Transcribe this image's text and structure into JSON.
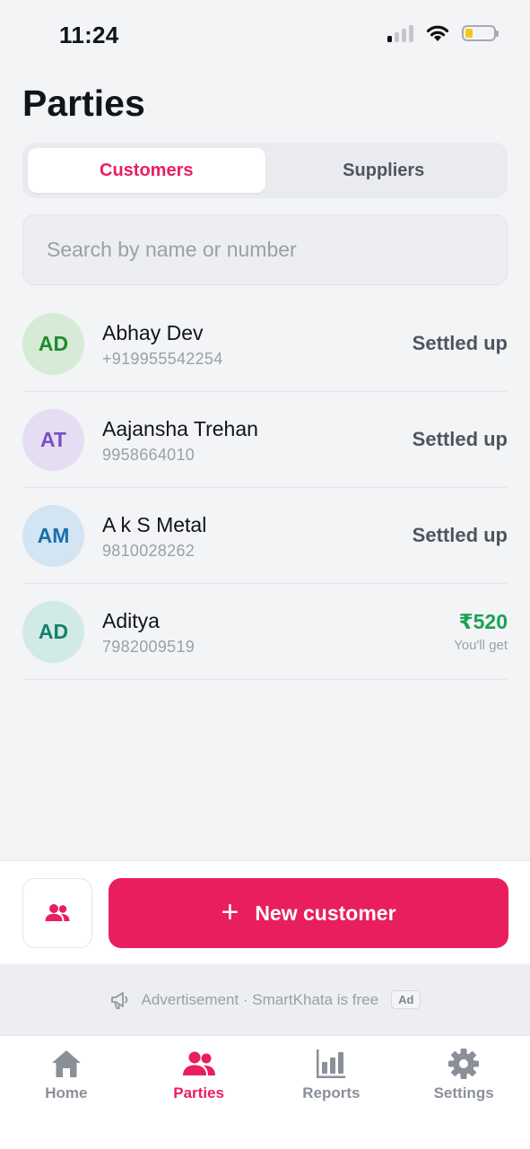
{
  "status_bar": {
    "time": "11:24"
  },
  "page": {
    "title": "Parties"
  },
  "segments": [
    {
      "label": "Customers",
      "active": true
    },
    {
      "label": "Suppliers",
      "active": false
    }
  ],
  "search": {
    "placeholder": "Search by name or number",
    "value": ""
  },
  "parties": [
    {
      "initials": "AD",
      "name": "Abhay Dev",
      "phone": "+919955542254",
      "status": "Settled up",
      "avatar_bg": "#d5ebd6",
      "avatar_fg": "#218a2d"
    },
    {
      "initials": "AT",
      "name": "Aajansha Trehan",
      "phone": "9958664010",
      "status": "Settled up",
      "avatar_bg": "#e5def3",
      "avatar_fg": "#7a4fc0"
    },
    {
      "initials": "AM",
      "name": "A k S Metal",
      "phone": "9810028262",
      "status": "Settled up",
      "avatar_bg": "#d3e4f2",
      "avatar_fg": "#1a6fad"
    },
    {
      "initials": "AD",
      "name": "Aditya",
      "phone": "7982009519",
      "amount": "₹520",
      "amount_note": "You'll get",
      "avatar_bg": "#d2eae5",
      "avatar_fg": "#17806d"
    }
  ],
  "actions": {
    "new_customer_label": "New customer"
  },
  "ad": {
    "text": "Advertisement · SmartKhata is free",
    "badge": "Ad"
  },
  "tabs": [
    {
      "label": "Home",
      "icon": "home-icon",
      "active": false
    },
    {
      "label": "Parties",
      "icon": "people-icon",
      "active": true
    },
    {
      "label": "Reports",
      "icon": "bar-chart-icon",
      "active": false
    },
    {
      "label": "Settings",
      "icon": "gear-icon",
      "active": false
    }
  ],
  "colors": {
    "accent": "#e91e5e",
    "positive": "#1aa251",
    "muted": "#9aa0a8",
    "battery_level": "#f5c518"
  },
  "battery_level": 0.25
}
